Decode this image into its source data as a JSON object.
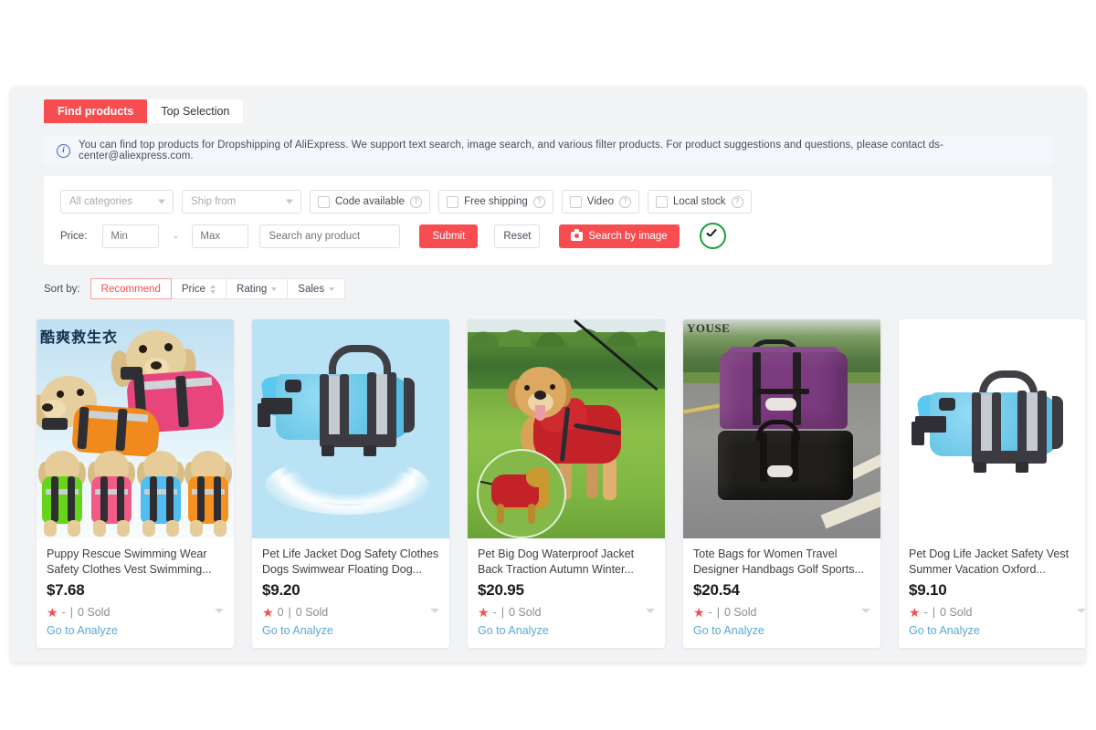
{
  "tabs": [
    {
      "label": "Find products",
      "active": true
    },
    {
      "label": "Top Selection",
      "active": false
    }
  ],
  "info": {
    "text": "You can find top products for Dropshipping of AliExpress. We support text search, image search, and various filter products. For product suggestions and questions, please contact ds-center@aliexpress.com.",
    "icon": "info-icon"
  },
  "filters": {
    "category_select": {
      "value": "All categories",
      "icon": "chevron-down-icon"
    },
    "ship_from_select": {
      "value": "Ship from",
      "icon": "chevron-down-icon"
    },
    "checkboxes": [
      {
        "label": "Code available",
        "checked": false,
        "help": "?"
      },
      {
        "label": "Free shipping",
        "checked": false,
        "help": "?"
      },
      {
        "label": "Video",
        "checked": false,
        "help": "?"
      },
      {
        "label": "Local stock",
        "checked": false,
        "help": "?"
      }
    ],
    "price_label": "Price:",
    "price_min": {
      "value": "",
      "placeholder": "Min"
    },
    "price_separator": "-",
    "price_max": {
      "value": "",
      "placeholder": "Max"
    },
    "keyword": {
      "value": "",
      "placeholder": "Search any product"
    },
    "submit_label": "Submit",
    "reset_label": "Reset",
    "search_by_image_label": "Search by image",
    "camera_icon": "camera-icon",
    "status_icon": "check-circle-icon"
  },
  "sort": {
    "label": "Sort by:",
    "options": [
      {
        "label": "Recommend",
        "active": true,
        "arrows": "none"
      },
      {
        "label": "Price",
        "active": false,
        "arrows": "both"
      },
      {
        "label": "Rating",
        "active": false,
        "arrows": "down"
      },
      {
        "label": "Sales",
        "active": false,
        "arrows": "down"
      }
    ]
  },
  "products": [
    {
      "title": "Puppy Rescue Swimming Wear Safety Clothes Vest Swimming...",
      "price": "$7.68",
      "rating": "-",
      "sold": "0 Sold",
      "separator": "|",
      "link": "Go to Analyze",
      "image_overlay_text": "酷爽救生衣",
      "image_alt": "puppies-in-life-jackets"
    },
    {
      "title": "Pet Life Jacket Dog Safety Clothes Dogs Swimwear Floating Dog...",
      "price": "$9.20",
      "rating": "0",
      "sold": "0 Sold",
      "separator": "|",
      "link": "Go to Analyze",
      "image_overlay_text": "",
      "image_alt": "blue-dog-life-jacket-on-blue"
    },
    {
      "title": "Pet Big Dog Waterproof Jacket Back Traction Autumn Winter...",
      "price": "$20.95",
      "rating": "-",
      "sold": "0 Sold",
      "separator": "|",
      "link": "Go to Analyze",
      "image_overlay_text": "",
      "image_alt": "golden-retriever-in-red-jacket"
    },
    {
      "title": "Tote Bags for Women Travel Designer Handbags Golf Sports...",
      "price": "$20.54",
      "rating": "-",
      "sold": "0 Sold",
      "separator": "|",
      "link": "Go to Analyze",
      "image_overlay_text": "YOUSE",
      "image_alt": "purple-and-black-tote-bags"
    },
    {
      "title": "Pet Dog Life Jacket Safety Vest Summer Vacation Oxford...",
      "price": "$9.10",
      "rating": "-",
      "sold": "0 Sold",
      "separator": "|",
      "link": "Go to Analyze",
      "image_overlay_text": "",
      "image_alt": "blue-dog-life-jacket-on-white"
    }
  ],
  "colors": {
    "accent": "#f74d51",
    "link": "#5aa7d4",
    "success": "#17a038",
    "panel_bg": "#f2f3f5",
    "info_bg": "#f4f6fb"
  }
}
